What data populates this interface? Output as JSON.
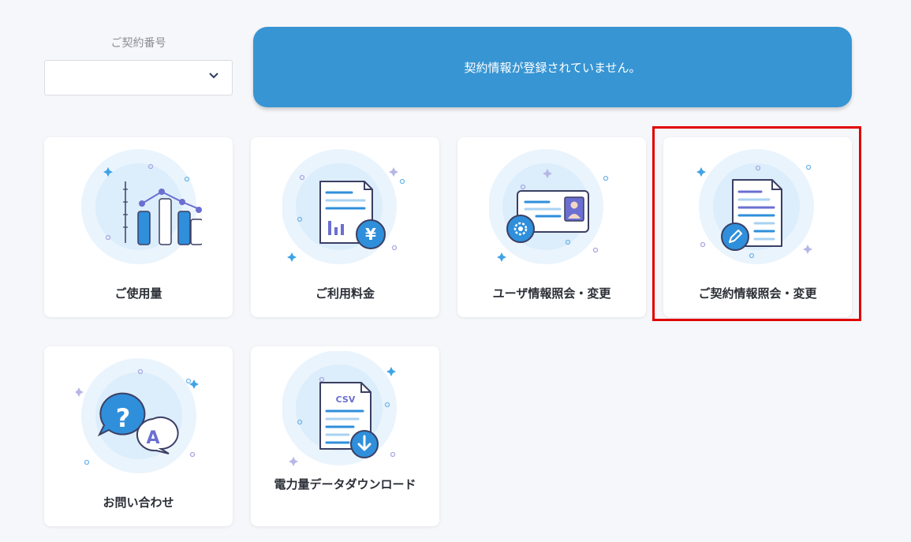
{
  "contract": {
    "label": "ご契約番号",
    "selected_value": ""
  },
  "banner": {
    "message": "契約情報が登録されていません。"
  },
  "tiles": [
    {
      "label": "ご使用量",
      "icon": "usage-chart-icon"
    },
    {
      "label": "ご利用料金",
      "icon": "yen-bill-icon"
    },
    {
      "label": "ユーザ情報照会・変更",
      "icon": "id-card-gear-icon"
    },
    {
      "label": "ご契約情報照会・変更",
      "icon": "document-edit-icon",
      "highlighted": true
    },
    {
      "label": "お問い合わせ",
      "icon": "question-speech-bubble-icon"
    },
    {
      "label": "電力量データダウンロード",
      "icon": "csv-download-icon"
    }
  ],
  "csv_icon_text": "CSV",
  "colors": {
    "banner": "#3795d3",
    "icon_blue": "#2f8fdb",
    "icon_purple": "#6b6fd1",
    "highlight": "#e00000"
  }
}
